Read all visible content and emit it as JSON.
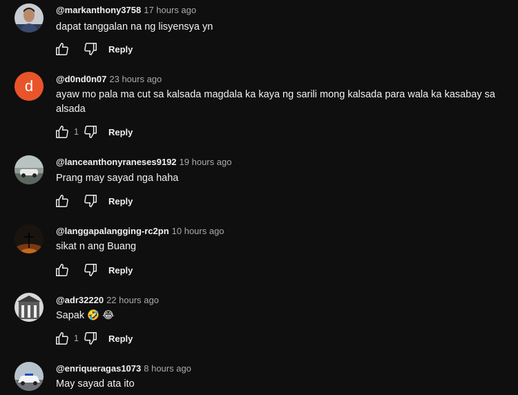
{
  "comments": [
    {
      "author": "@markanthony3758",
      "time": "17 hours ago",
      "text": "dapat tanggalan na ng lisyensya yn",
      "likes": "",
      "reply_label": "Reply",
      "avatar": "photo-man"
    },
    {
      "author": "@d0nd0n07",
      "time": "23 hours ago",
      "text": "ayaw mo pala ma cut sa kalsada magdala ka kaya ng sarili mong kalsada para wala ka kasabay sa alsada",
      "likes": "1",
      "reply_label": "Reply",
      "avatar": "letter",
      "avatar_letter": "d",
      "avatar_color": "#e9542a"
    },
    {
      "author": "@lanceanthonyraneses9192",
      "time": "19 hours ago",
      "text": "Prang may sayad nga haha",
      "likes": "",
      "reply_label": "Reply",
      "avatar": "photo-car"
    },
    {
      "author": "@langgapalangging-rc2pn",
      "time": "10 hours ago",
      "text": "sikat n ang Buang",
      "likes": "",
      "reply_label": "Reply",
      "avatar": "photo-sunset"
    },
    {
      "author": "@adr32220",
      "time": "22 hours ago",
      "text": "Sapak 🤣 😂",
      "likes": "1",
      "reply_label": "Reply",
      "avatar": "photo-building"
    },
    {
      "author": "@enriqueragas1073",
      "time": "8 hours ago",
      "text": "May sayad ata ito",
      "likes": "",
      "reply_label": "Reply",
      "avatar": "photo-police-car"
    }
  ],
  "icons": {
    "like": "thumbs-up-icon",
    "dislike": "thumbs-down-icon"
  },
  "colors": {
    "background": "#0f0f0f",
    "text": "#f1f1f1",
    "secondary_text": "#aaaaaa"
  }
}
